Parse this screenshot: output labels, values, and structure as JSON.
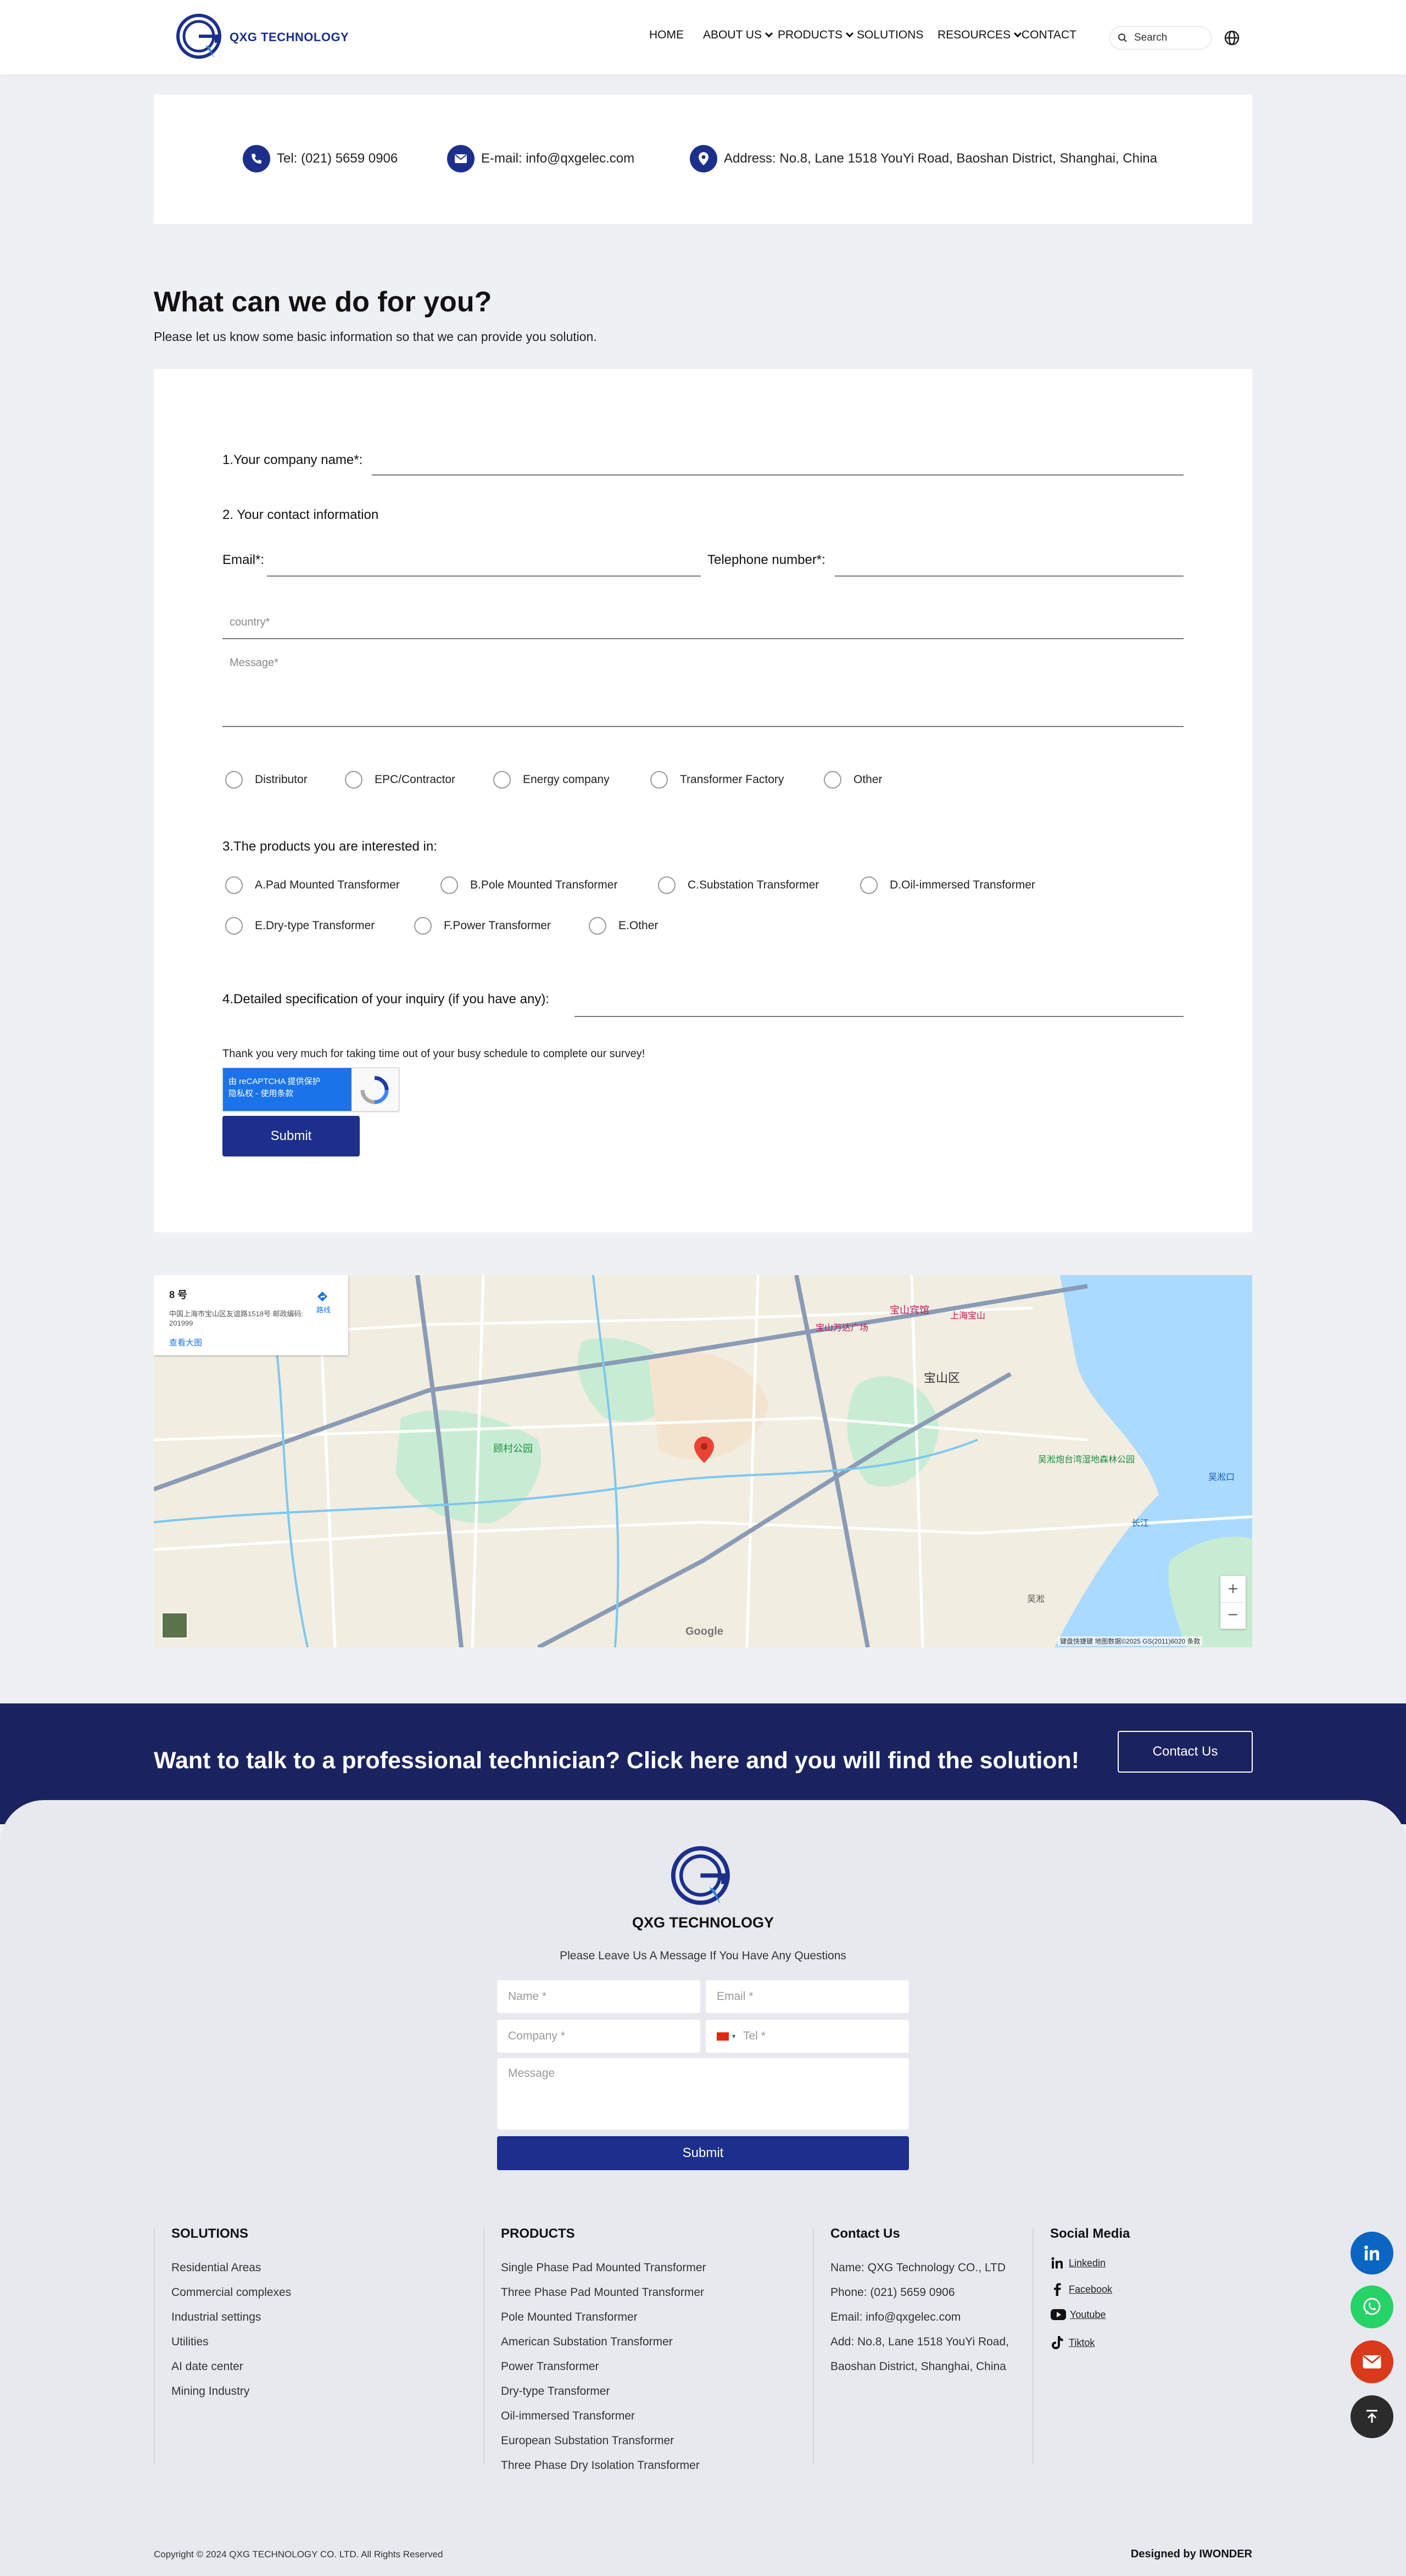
{
  "header": {
    "logo_text": "QXG TECHNOLOGY",
    "nav": [
      "HOME",
      "ABOUT US",
      "PRODUCTS",
      "SOLUTIONS",
      "RESOURCES",
      "CONTACT"
    ],
    "search_placeholder": "Search"
  },
  "contact_bar": {
    "tel": "Tel: (021) 5659 0906",
    "email": "E-mail: info@qxgelec.com",
    "address": "Address: No.8, Lane 1518 YouYi Road, Baoshan District, Shanghai, China"
  },
  "intro": {
    "title": "What can we do for you?",
    "subtitle": "Please let us know some basic information so that we can provide you solution."
  },
  "form": {
    "q1": "1.Your company name*:",
    "q2": "2. Your contact information",
    "email_label": "Email*:",
    "tel_label": "Telephone number*:",
    "country_placeholder": "country*",
    "message_placeholder": "Message*",
    "roles": [
      "Distributor",
      "EPC/Contractor",
      "Energy company",
      "Transformer Factory",
      "Other"
    ],
    "q3": "3.The products you are interested in:",
    "products": [
      "A.Pad Mounted Transformer",
      "B.Pole Mounted Transformer",
      "C.Substation Transformer",
      "D.Oil-immersed Transformer",
      "E.Dry-type Transformer",
      "F.Power Transformer",
      "E.Other"
    ],
    "q4": "4.Detailed specification of your inquiry (if you have any):",
    "thanks": "Thank you very much for taking time out of your busy schedule to complete our survey!",
    "recaptcha_line1": "由 reCAPTCHA 提供保护",
    "recaptcha_line2": "隐私权 - 使用条款",
    "submit": "Submit"
  },
  "map": {
    "info_title": "8 号",
    "info_address": "中国上海市宝山区友谊路1518号 邮政编码: 201999",
    "info_route": "路线",
    "info_larger": "查看大图",
    "attribution": "键盘快捷键  地图数据©2025 GS(2011)6020  条款",
    "google": "Google",
    "labels": [
      "宝山区",
      "顾村公园",
      "宝山宾馆",
      "吴淞口",
      "长江",
      "吴淞炮台湾湿地森林公园",
      "宝山万达广场",
      "上海宝山",
      "吴淞"
    ]
  },
  "cta": {
    "text": "Want to talk to a professional technician? Click here and you will find the solution!",
    "button": "Contact Us"
  },
  "footer": {
    "logo_text": "QXG TECHNOLOGY",
    "message_prompt": "Please Leave Us A Message If You Have Any Questions",
    "name_ph": "Name *",
    "email_ph": "Email *",
    "company_ph": "Company *",
    "tel_ph": "Tel *",
    "message_ph": "Message",
    "submit": "Submit",
    "solutions_title": "SOLUTIONS",
    "solutions": [
      "Residential Areas",
      "Commercial complexes",
      "Industrial settings",
      "Utilities",
      "AI date center",
      "Mining Industry"
    ],
    "products_title": "PRODUCTS",
    "products": [
      "Single Phase Pad Mounted Transformer",
      "Three Phase Pad Mounted Transformer",
      "Pole Mounted Transformer",
      "American Substation Transformer",
      "Power Transformer",
      "Dry-type Transformer",
      "Oil-immersed Transformer",
      "European Substation Transformer",
      "Three Phase Dry Isolation Transformer"
    ],
    "contact_title": "Contact Us",
    "contact": [
      "Name: QXG Technology CO., LTD",
      "Phone: (021) 5659 0906",
      "Email: info@qxgelec.com",
      "Add: No.8, Lane 1518 YouYi Road,",
      "Baoshan District, Shanghai, China"
    ],
    "social_title": "Social Media",
    "social": [
      "Linkedin",
      "Facebook",
      "Youtube",
      "Tiktok"
    ],
    "copyright": "Copyright © 2024 QXG TECHNOLOGY CO. LTD. All Rights Reserved",
    "designed": "Designed by IWONDER"
  },
  "colors": {
    "brand": "#1c2f8c",
    "cta_bg": "#1a2360",
    "whatsapp": "#25d366",
    "mail": "#d93a1b",
    "linkedin": "#0a66c2"
  },
  "icons": [
    "phone-icon",
    "mail-icon",
    "location-icon",
    "search-icon",
    "globe-icon",
    "linkedin-icon",
    "facebook-icon",
    "youtube-icon",
    "tiktok-icon",
    "whatsapp-icon",
    "back-to-top-icon"
  ]
}
